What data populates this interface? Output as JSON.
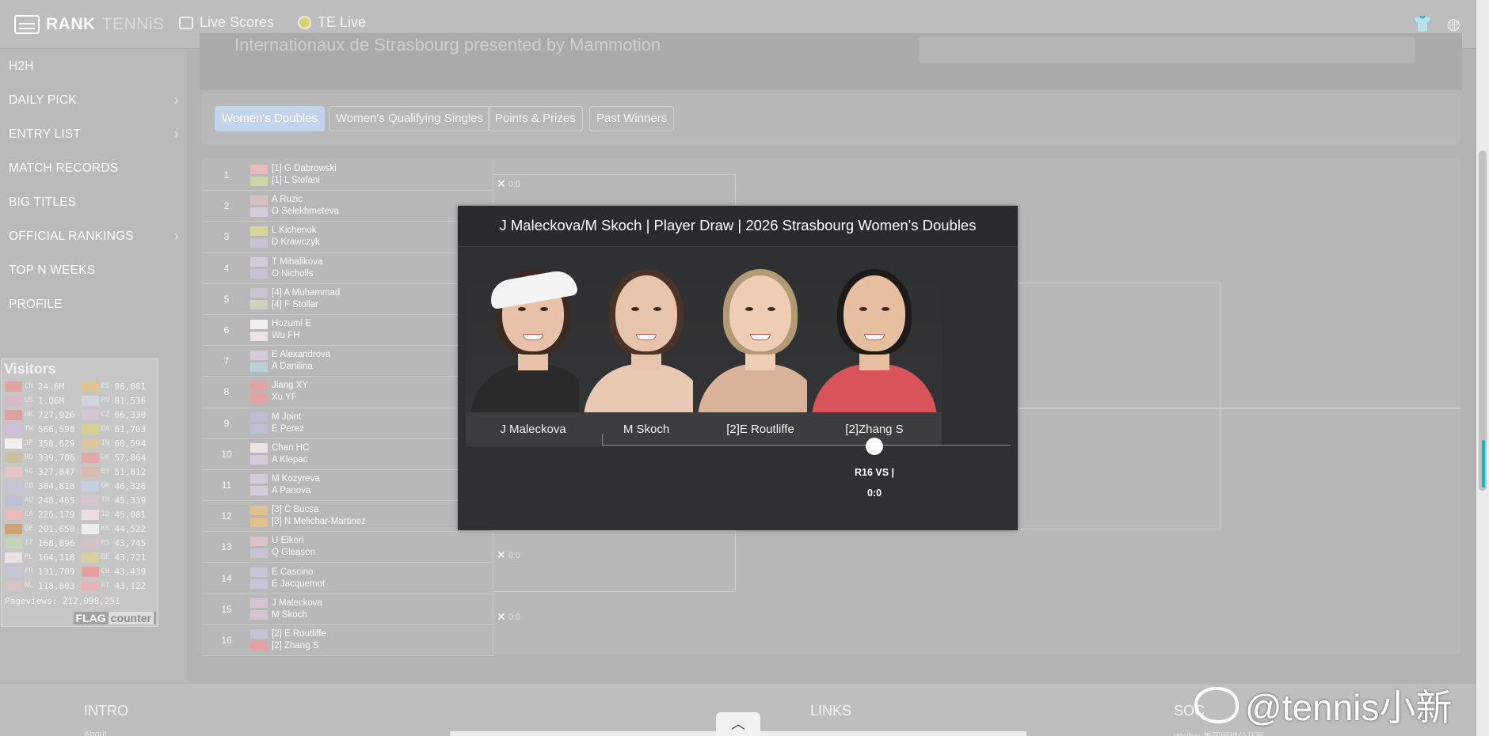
{
  "brand": {
    "name_a": "RANK",
    "name_b": "TENNiS"
  },
  "topnav": [
    {
      "label": "Live Scores",
      "icon": "tv-icon"
    },
    {
      "label": "TE Live",
      "icon": "tennis-ball-icon"
    }
  ],
  "sidebar": {
    "items": [
      {
        "label": "H2H",
        "has_arrow": false
      },
      {
        "label": "DAILY PICK",
        "has_arrow": true
      },
      {
        "label": "ENTRY LIST",
        "has_arrow": true
      },
      {
        "label": "MATCH RECORDS",
        "has_arrow": false
      },
      {
        "label": "BIG TITLES",
        "has_arrow": false
      },
      {
        "label": "OFFICIAL RANKINGS",
        "has_arrow": true
      },
      {
        "label": "TOP N WEEKS",
        "has_arrow": false
      },
      {
        "label": "PROFILE",
        "has_arrow": false
      }
    ]
  },
  "visitors": {
    "title": "Visitors",
    "left": [
      {
        "cc": "CN",
        "count": "24.6M",
        "color": "#e4a3a3"
      },
      {
        "cc": "US",
        "count": "1.06M",
        "color": "#d7b9c8"
      },
      {
        "cc": "HK",
        "count": "727,926",
        "color": "#e0a0a0"
      },
      {
        "cc": "TW",
        "count": "566,590",
        "color": "#cdc0d8"
      },
      {
        "cc": "JP",
        "count": "358,629",
        "color": "#f3efef"
      },
      {
        "cc": "RO",
        "count": "339,706",
        "color": "#c9c09f"
      },
      {
        "cc": "SG",
        "count": "327,847",
        "color": "#e8c4c4"
      },
      {
        "cc": "GB",
        "count": "304,818",
        "color": "#c7c2d4"
      },
      {
        "cc": "AU",
        "count": "248,465",
        "color": "#bdbdd4"
      },
      {
        "cc": "CA",
        "count": "226,179",
        "color": "#e8bcbc"
      },
      {
        "cc": "DE",
        "count": "201,650",
        "color": "#cfa26f"
      },
      {
        "cc": "IT",
        "count": "168,896",
        "color": "#c5d4b8"
      },
      {
        "cc": "PL",
        "count": "164,118",
        "color": "#ece0e0"
      },
      {
        "cc": "FR",
        "count": "131,709",
        "color": "#c9c5d9"
      },
      {
        "cc": "NL",
        "count": "118,803",
        "color": "#d6c3c3"
      }
    ],
    "right": [
      {
        "cc": "ES",
        "count": "88,081",
        "color": "#e0c28c"
      },
      {
        "cc": "RU",
        "count": "81,536",
        "color": "#d6d1df"
      },
      {
        "cc": "CZ",
        "count": "66,330",
        "color": "#d5c5d2"
      },
      {
        "cc": "UA",
        "count": "61,703",
        "color": "#d5d193"
      },
      {
        "cc": "IN",
        "count": "60,594",
        "color": "#dcc79d"
      },
      {
        "cc": "DK",
        "count": "57,864",
        "color": "#e2a8a8"
      },
      {
        "cc": "BY",
        "count": "51,812",
        "color": "#d9b9b0"
      },
      {
        "cc": "GR",
        "count": "46,326",
        "color": "#c5cfdf"
      },
      {
        "cc": "TH",
        "count": "45,339",
        "color": "#d5c3cf"
      },
      {
        "cc": "ID",
        "count": "45,081",
        "color": "#ecdede"
      },
      {
        "cc": "KR",
        "count": "44,522",
        "color": "#ededed"
      },
      {
        "cc": "RS",
        "count": "43,745",
        "color": "#d3c3c8"
      },
      {
        "cc": "BE",
        "count": "43,721",
        "color": "#d8cf9e"
      },
      {
        "cc": "CH",
        "count": "43,439",
        "color": "#e49e9e"
      },
      {
        "cc": "AT",
        "count": "43,122",
        "color": "#e4b3b3"
      }
    ],
    "pageviews": "Pageviews: 212,098,251",
    "badge_a": "FLAG",
    "badge_b": "counter"
  },
  "header": {
    "tournament": "Internationaux de Strasbourg presented by Mammotion"
  },
  "tabs": [
    {
      "label": "Women's Doubles",
      "active": true
    },
    {
      "label": "Women's Qualifying Singles",
      "active": false
    },
    {
      "label": "Points & Prizes",
      "active": false
    },
    {
      "label": "Past Winners",
      "active": false
    }
  ],
  "draw": [
    {
      "n": "1",
      "p1": "[1] G Dabrowski",
      "p2": "[1] L Stefani",
      "f1": "#e7bcbc",
      "f2": "#c9d6a6"
    },
    {
      "n": "2",
      "p1": "A Ruzic",
      "p2": "O Selekhmeteva",
      "f1": "#d8c0c4",
      "f2": "#d3cbd9"
    },
    {
      "n": "3",
      "p1": "L Kichenok",
      "p2": "D Krawczyk",
      "f1": "#dad39c",
      "f2": "#c9c2d4"
    },
    {
      "n": "4",
      "p1": "T Mihalikova",
      "p2": "O Nicholls",
      "f1": "#d3cbd9",
      "f2": "#c9c2d4"
    },
    {
      "n": "5",
      "p1": "[4] A Muhammad",
      "p2": "[4] F Stollar",
      "f1": "#c9c2d4",
      "f2": "#cdd3bd"
    },
    {
      "n": "6",
      "p1": "Hozumi E",
      "p2": "Wu FH",
      "f1": "#f1eeee",
      "f2": "#ece4e4"
    },
    {
      "n": "7",
      "p1": "E Alexandrova",
      "p2": "A Danilina",
      "f1": "#d3cbd9",
      "f2": "#b8d3d8"
    },
    {
      "n": "8",
      "p1": "Jiang XY",
      "p2": "Xu YF",
      "f1": "#e4a3a3",
      "f2": "#e4a3a3"
    },
    {
      "n": "9",
      "p1": "M Joint",
      "p2": "E Perez",
      "f1": "#bdbdd4",
      "f2": "#bdbdd4"
    },
    {
      "n": "10",
      "p1": "Chan HC",
      "p2": "A Klepac",
      "f1": "#ece4e4",
      "f2": "#d3cbd9"
    },
    {
      "n": "11",
      "p1": "M Kozyreva",
      "p2": "A Panova",
      "f1": "#d3cbd9",
      "f2": "#d3cbd9"
    },
    {
      "n": "12",
      "p1": "[3] C Bucsa",
      "p2": "[3] N Melichar-Martinez",
      "f1": "#e0c28c",
      "f2": "#e0c28c"
    },
    {
      "n": "13",
      "p1": "U Eikeri",
      "p2": "Q Gleason",
      "f1": "#dcc4c4",
      "f2": "#c9c2d4"
    },
    {
      "n": "14",
      "p1": "E Cascino",
      "p2": "E Jacquemot",
      "f1": "#c9c5d9",
      "f2": "#c9c5d9"
    },
    {
      "n": "15",
      "p1": "J Maleckova",
      "p2": "M Skoch",
      "f1": "#d5c5d2",
      "f2": "#d5c5d2"
    },
    {
      "n": "16",
      "p1": "[2] E Routliffe",
      "p2": "[2] Zhang S",
      "f1": "#c7c2d4",
      "f2": "#e4a3a3"
    }
  ],
  "scores": {
    "s1": "0:0",
    "s13": "0:0",
    "s15": "0:0"
  },
  "modal": {
    "title": "J Maleckova/M Skoch | Player Draw | 2026 Strasbourg Women's Doubles",
    "players": [
      {
        "name": "J Maleckova",
        "skin": "#e7c2a8",
        "hair": "#3a2a22",
        "shirt": "#2a2a2a",
        "visor": true
      },
      {
        "name": "M Skoch",
        "skin": "#e9c4ad",
        "hair": "#4a3327",
        "shirt": "#e9c9b4",
        "visor": false
      },
      {
        "name": "[2]E Routliffe",
        "skin": "#efcdb5",
        "hair": "#b39a74",
        "shirt": "#d8b39a",
        "visor": false
      },
      {
        "name": "[2]Zhang S",
        "skin": "#e6bfa1",
        "hair": "#1d1a18",
        "shirt": "#d9545a",
        "visor": false
      }
    ],
    "round": "R16 VS |",
    "score": "0:0"
  },
  "footer": {
    "intro": "INTRO",
    "about": "About",
    "links": "LINKS",
    "social": "SOC",
    "weibo_note": "Weibo: 美国网球公开赛"
  },
  "watermark": {
    "text": "@tennis小新"
  }
}
